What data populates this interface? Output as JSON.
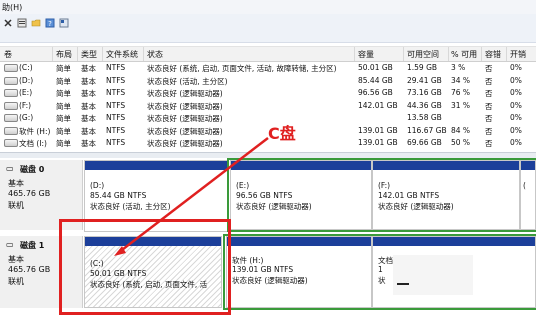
{
  "menubar": {
    "text": "助(H)"
  },
  "toolbar": {
    "icons": [
      "close-icon",
      "properties-icon",
      "folder-icon",
      "help-icon",
      "view-icon"
    ]
  },
  "columns": [
    "卷",
    "布局",
    "类型",
    "文件系统",
    "状态",
    "容量",
    "可用空间",
    "% 可用",
    "容错",
    "开销"
  ],
  "volumes": [
    {
      "name": "(C:)",
      "layout": "简单",
      "type": "基本",
      "fs": "NTFS",
      "status": "状态良好 (系统, 启动, 页面文件, 活动, 故障转储, 主分区)",
      "capacity": "50.01 GB",
      "free": "1.59 GB",
      "pct": "3 %",
      "ft": "否",
      "overhead": "0%"
    },
    {
      "name": "(D:)",
      "layout": "简单",
      "type": "基本",
      "fs": "NTFS",
      "status": "状态良好 (活动, 主分区)",
      "capacity": "85.44 GB",
      "free": "29.41 GB",
      "pct": "34 %",
      "ft": "否",
      "overhead": "0%"
    },
    {
      "name": "(E:)",
      "layout": "简单",
      "type": "基本",
      "fs": "NTFS",
      "status": "状态良好 (逻辑驱动器)",
      "capacity": "96.56 GB",
      "free": "73.16 GB",
      "pct": "76 %",
      "ft": "否",
      "overhead": "0%"
    },
    {
      "name": "(F:)",
      "layout": "简单",
      "type": "基本",
      "fs": "NTFS",
      "status": "状态良好 (逻辑驱动器)",
      "capacity": "142.01 GB",
      "free": "44.36 GB",
      "pct": "31 %",
      "ft": "否",
      "overhead": "0%"
    },
    {
      "name": "(G:)",
      "layout": "简单",
      "type": "基本",
      "fs": "NTFS",
      "status": "状态良好 (逻辑驱动器)",
      "capacity": "",
      "free": "13.58 GB",
      "pct": "",
      "ft": "否",
      "overhead": "0%"
    },
    {
      "name": "软件 (H:)",
      "layout": "简单",
      "type": "基本",
      "fs": "NTFS",
      "status": "状态良好 (逻辑驱动器)",
      "capacity": "139.01 GB",
      "free": "116.67 GB",
      "pct": "84 %",
      "ft": "否",
      "overhead": "0%"
    },
    {
      "name": "文档 (I:)",
      "layout": "简单",
      "type": "基本",
      "fs": "NTFS",
      "status": "状态良好 (逻辑驱动器)",
      "capacity": "139.01 GB",
      "free": "69.66 GB",
      "pct": "50 %",
      "ft": "否",
      "overhead": "0%"
    }
  ],
  "disk0": {
    "name": "磁盘 0",
    "type": "基本",
    "size": "465.76 GB",
    "state": "联机",
    "parts": [
      {
        "label": "(D:)",
        "size": "85.44 GB NTFS",
        "status": "状态良好 (活动, 主分区)"
      },
      {
        "label": "(E:)",
        "size": "96.56 GB NTFS",
        "status": "状态良好 (逻辑驱动器)"
      },
      {
        "label": "(F:)",
        "size": "142.01 GB NTFS",
        "status": "状态良好 (逻辑驱动器)"
      },
      {
        "label": "(",
        "size": "",
        "status": ""
      }
    ]
  },
  "disk1": {
    "name": "磁盘 1",
    "type": "基本",
    "size": "465.76 GB",
    "state": "联机",
    "parts": [
      {
        "label": "(C:)",
        "size": "50.01 GB NTFS",
        "status": "状态良好 (系统, 启动, 页面文件, 活"
      },
      {
        "label": "软件 (H:)",
        "size": "139.01 GB NTFS",
        "status": "状态良好 (逻辑驱动器)"
      },
      {
        "label": "文档",
        "size": "1",
        "status": "状"
      }
    ]
  },
  "annotation": {
    "text": "C盘"
  }
}
